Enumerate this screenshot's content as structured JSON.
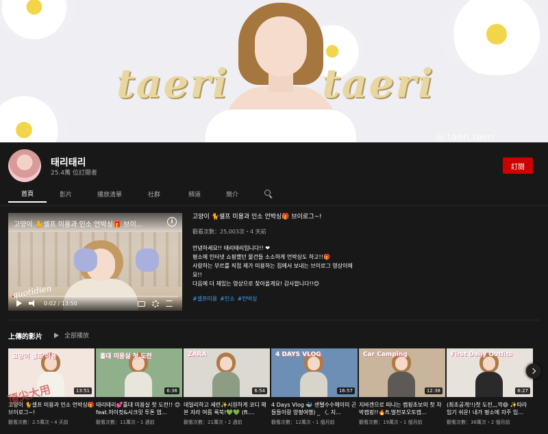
{
  "banner": {
    "script_text_left": "taeri",
    "script_text_right": "taeri",
    "handle": "taeri.taeri"
  },
  "channel": {
    "name": "태리태리",
    "subscribers": "25.4萬 位訂閱者",
    "subscribe_label": "訂閱"
  },
  "tabs": [
    {
      "label": "首頁",
      "active": true
    },
    {
      "label": "影片",
      "active": false
    },
    {
      "label": "播放清單",
      "active": false
    },
    {
      "label": "社群",
      "active": false
    },
    {
      "label": "頻道",
      "active": false
    },
    {
      "label": "簡介",
      "active": false
    }
  ],
  "featured": {
    "player_title": "고양이 🐈셀프 미용과 인소 언박싱🎁 브이...",
    "title": "고양이 🐈셀프 미용과 인소 언박싱🎁 브이로그~!",
    "meta": "觀看次數：25,003次・4 天前",
    "time": "0:02 / 13:50",
    "progress": 0.01,
    "cursive": "quotidien",
    "description": [
      "안녕하세요!! 태리태리입니다!! ❤",
      "평소에 인터넷 쇼핑했던 물건들 소소하게 언박싱도 하고!!🎁",
      "사랑하는 부르를 직접 제가 미용하는 집에서 보내는 브이로그 영상이에",
      "요!!",
      "다음에 더 재있는 영상으로 찾아올게요! 감사합니다!!😊"
    ],
    "tags": [
      "#셀프미용",
      "#인소",
      "#언박싱"
    ]
  },
  "uploads": {
    "title": "上傳的影片",
    "play_all": "全部播放",
    "videos": [
      {
        "thumb_text": "고양이 셀프 미용",
        "duration": "13:51",
        "title": "고양이 🐈셀프 미용과 인소 언박싱🎁 브이로그~!",
        "meta": "觀看次數：2.5萬次・4 天前",
        "bg": "#f3e6df",
        "body": "#f4f0ea"
      },
      {
        "thumb_text": "홀대 미용실 첫 도전",
        "duration": "6:36",
        "title": "태리태리💕홀대 미용실 첫 도전!! 😊feat.허이컷&시크릿 투톤 염...",
        "meta": "觀看次數：11萬次・1 週前",
        "bg": "#8fb08a",
        "body": "#e9e4dc"
      },
      {
        "thumb_text": "ZARA",
        "duration": "6:54",
        "title": "데일리하고 세련✨시원하게 코디 해본 자라 여름 룩북!💚💚 (ft....",
        "meta": "觀看次數：21萬次・2 週前",
        "bg": "#dcd8d2",
        "body": "#8c9d84"
      },
      {
        "thumb_text": "4 DAYS VLOG",
        "duration": "16:57",
        "title": "4 Days Vlog 🐳 센텔수수헤이미 곤들들이랑 양평여행) _ 〈, 지...",
        "meta": "觀看次數：12萬次・1 個月前",
        "bg": "#6d8fb5",
        "body": "#d9d4ca"
      },
      {
        "thumb_text": "Car Camping",
        "duration": "12:38",
        "title": "지바겐으로 떠나는 캠핑초보의 첫 차박캠핑!!🔥ft.벌천포오토캠...",
        "meta": "觀看次數：19萬次・1 個月前",
        "bg": "#c9b59c",
        "body": "#5d5a55"
      },
      {
        "thumb_text": "First Daily Outfits",
        "duration": "6:27",
        "title": "(최초공개!!)첫 도전,,,깍😄 ✨따라 입기 쉬운! 내가 평소에 자주 입...",
        "meta": "觀看次數：38萬次・2 個月前",
        "bg": "#e8e2dc",
        "body": "#2a2a2a"
      }
    ]
  },
  "watermark": "頂尖大用"
}
